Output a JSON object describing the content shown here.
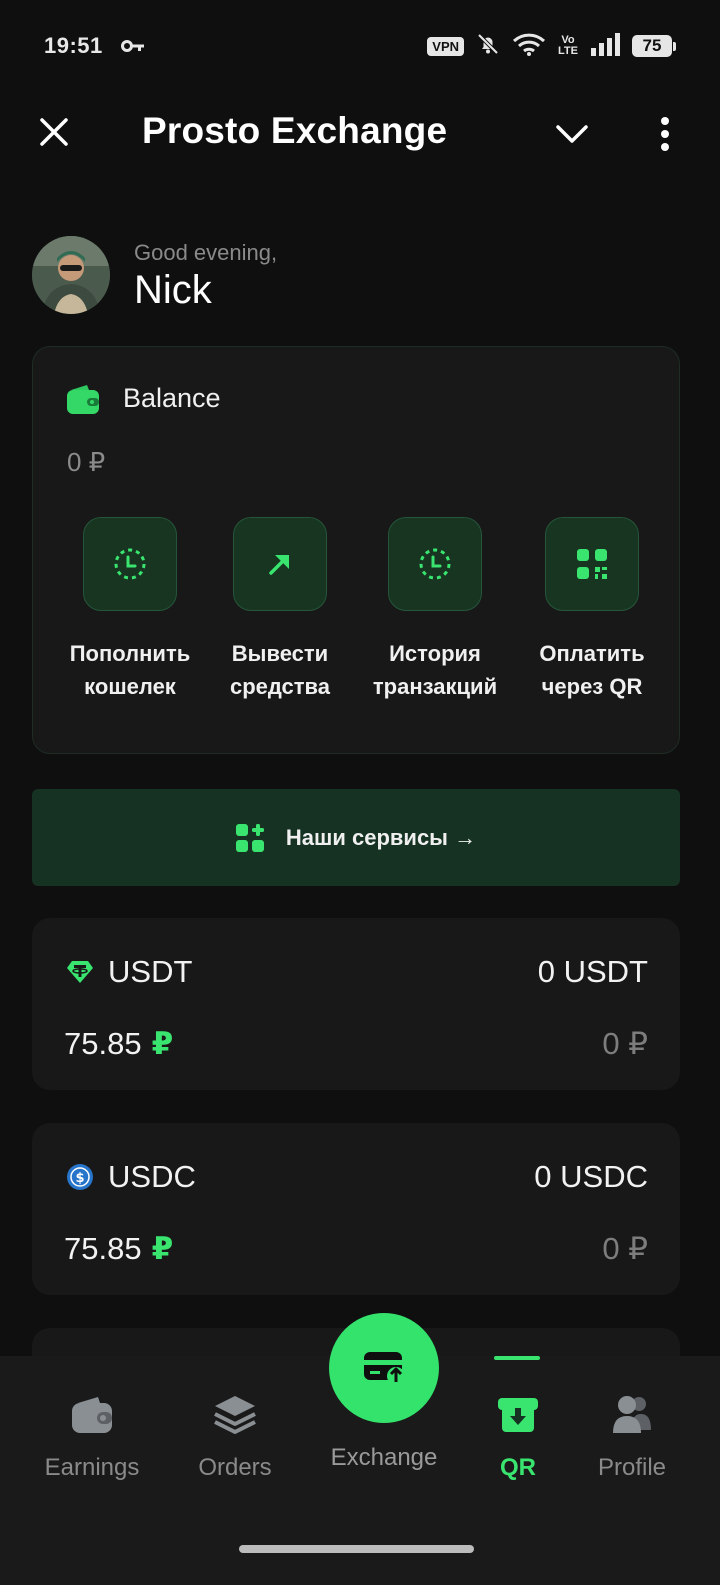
{
  "status_bar": {
    "time": "19:51",
    "vpn": "VPN",
    "volte_top": "Vo",
    "volte_bottom": "LTE",
    "battery": "75"
  },
  "app_bar": {
    "title": "Prosto Exchange",
    "icons": [
      "close-icon",
      "chevron-down-icon",
      "more-vertical-icon"
    ]
  },
  "user": {
    "greeting": "Good evening,",
    "name": "Nick"
  },
  "balance": {
    "label": "Balance",
    "value": "0 ₽",
    "actions": [
      {
        "line1": "Пополнить",
        "line2": "кошелек",
        "icon": "clock-icon"
      },
      {
        "line1": "Вывести",
        "line2": "средства",
        "icon": "arrow-up-right-icon"
      },
      {
        "line1": "История",
        "line2": "транзакций",
        "icon": "clock-icon"
      },
      {
        "line1": "Оплатить",
        "line2": "через QR",
        "icon": "qr-code-icon"
      }
    ]
  },
  "services": {
    "label": "Наши сервисы →"
  },
  "assets": [
    {
      "name": "USDT",
      "amount": "0 USDT",
      "rate": "75.85",
      "rate_symbol": "₽",
      "fiat": "0 ₽",
      "icon": "tether-icon"
    },
    {
      "name": "USDC",
      "amount": "0 USDC",
      "rate": "75.85",
      "rate_symbol": "₽",
      "fiat": "0 ₽",
      "icon": "usdc-icon"
    }
  ],
  "nav": {
    "items": [
      {
        "label": "Earnings",
        "icon": "wallet-icon"
      },
      {
        "label": "Orders",
        "icon": "layers-icon"
      },
      {
        "label": "Exchange",
        "icon": "card-exchange-icon"
      },
      {
        "label": "QR",
        "icon": "qr-download-icon"
      },
      {
        "label": "Profile",
        "icon": "users-icon"
      }
    ],
    "active": "QR"
  },
  "colors": {
    "accent": "#39e46f",
    "background": "#0f0f0f",
    "card": "#181818",
    "muted_text": "#8a8a8a"
  }
}
